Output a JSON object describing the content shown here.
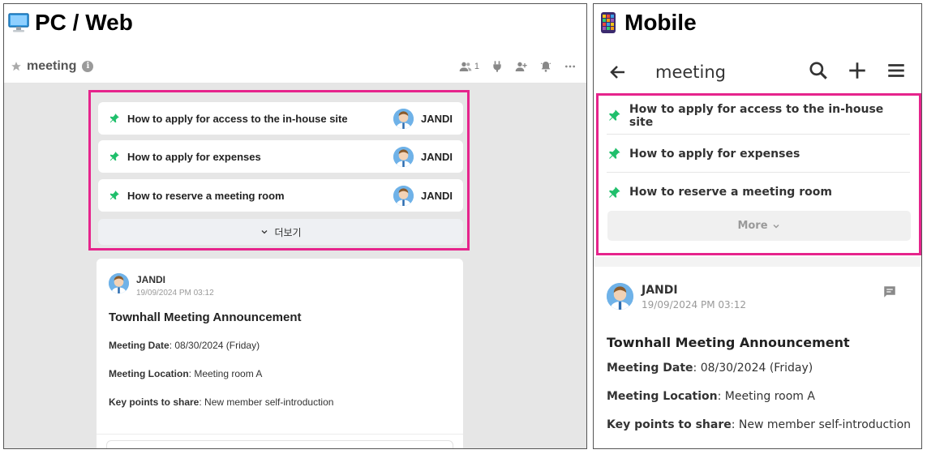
{
  "pc": {
    "label": "PC / Web",
    "header": {
      "channel_name": "meeting",
      "member_count": "1"
    },
    "pinned": [
      {
        "title": "How to apply for access to the in-house site",
        "author": "JANDI"
      },
      {
        "title": "How to apply for expenses",
        "author": "JANDI"
      },
      {
        "title": "How to reserve a meeting room",
        "author": "JANDI"
      }
    ],
    "more_label": "더보기",
    "message": {
      "author": "JANDI",
      "timestamp": "19/09/2024 PM 03:12",
      "title": "Townhall Meeting Announcement",
      "fields": [
        {
          "label": "Meeting Date",
          "value": ": 08/30/2024 (Friday)"
        },
        {
          "label": "Meeting Location",
          "value": ": Meeting room A"
        },
        {
          "label": "Key points to share",
          "value": ": New member self-introduction"
        }
      ]
    }
  },
  "mobile": {
    "label": "Mobile",
    "header": {
      "channel_name": "meeting"
    },
    "pinned": [
      {
        "title": "How to apply for access to the in-house site"
      },
      {
        "title": "How to apply for expenses"
      },
      {
        "title": "How to reserve a meeting room"
      }
    ],
    "more_label": "More",
    "message": {
      "author": "JANDI",
      "timestamp": "19/09/2024 PM 03:12",
      "title": "Townhall Meeting Announcement",
      "fields": [
        {
          "label": "Meeting Date",
          "value": ": 08/30/2024 (Friday)"
        },
        {
          "label": "Meeting Location",
          "value": ": Meeting room A"
        },
        {
          "label": "Key points to share",
          "value": ": New member self-introduction"
        }
      ]
    }
  },
  "colors": {
    "highlight": "#e6248c",
    "pin": "#1fbf6b",
    "avatar_bg": "#6fb2e8",
    "pc_canvas": "#e6e6e6"
  },
  "icons": [
    "monitor-icon",
    "mobile-app-icon",
    "star-icon",
    "info-icon",
    "members-icon",
    "plug-icon",
    "add-member-icon",
    "bell-icon",
    "more-icon",
    "pin-icon",
    "chevron-down-icon",
    "back-arrow-icon",
    "search-icon",
    "plus-icon",
    "menu-icon",
    "comment-icon"
  ]
}
